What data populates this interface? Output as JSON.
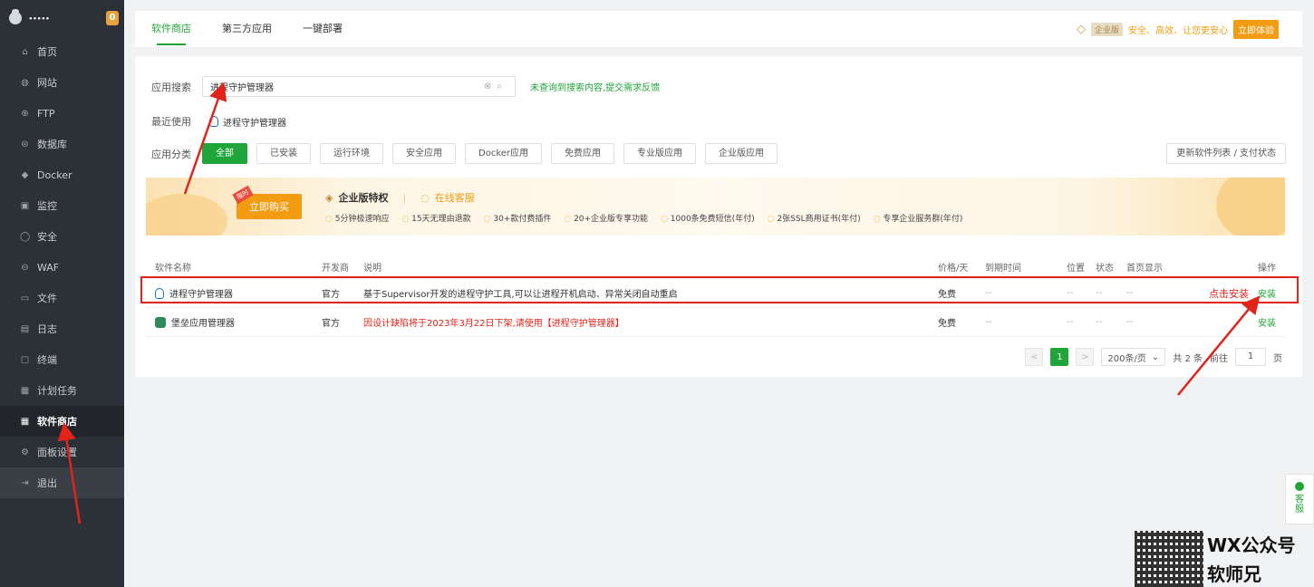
{
  "sidebar": {
    "username": "🞄🞄🞄🞄🞄",
    "badge": "0",
    "items": [
      {
        "label": "首页",
        "icon": "⌂"
      },
      {
        "label": "网站",
        "icon": "◍"
      },
      {
        "label": "FTP",
        "icon": "⊕"
      },
      {
        "label": "数据库",
        "icon": "⊜"
      },
      {
        "label": "Docker",
        "icon": "◆"
      },
      {
        "label": "监控",
        "icon": "▣"
      },
      {
        "label": "安全",
        "icon": "◯"
      },
      {
        "label": "WAF",
        "icon": "⊖"
      },
      {
        "label": "文件",
        "icon": "▭"
      },
      {
        "label": "日志",
        "icon": "▤"
      },
      {
        "label": "终端",
        "icon": "▢"
      },
      {
        "label": "计划任务",
        "icon": "▦"
      },
      {
        "label": "软件商店",
        "icon": "▦"
      },
      {
        "label": "面板设置",
        "icon": "⚙"
      },
      {
        "label": "退出",
        "icon": "⇥"
      }
    ]
  },
  "topbar": {
    "tabs": [
      "软件商店",
      "第三方应用",
      "一键部署"
    ],
    "ent_tag": "企业版",
    "ent_text": "安全、高效、让您更安心",
    "ent_btn": "立即体验"
  },
  "search": {
    "label": "应用搜索",
    "value": "进程守护管理器",
    "feedback": "未查询到搜索内容,提交需求反馈"
  },
  "recent": {
    "label": "最近使用",
    "item": "进程守护管理器"
  },
  "category": {
    "label": "应用分类",
    "items": [
      "全部",
      "已安装",
      "运行环境",
      "安全应用",
      "Docker应用",
      "免费应用",
      "专业版应用",
      "企业版应用"
    ],
    "refresh": "更新软件列表 / 支付状态"
  },
  "banner": {
    "buy": "立即购买",
    "hot": "限时",
    "privilege": "企业版特权",
    "service": "在线客服",
    "features": [
      "5分钟极速响应",
      "15天无理由退款",
      "30+款付费插件",
      "20+企业版专享功能",
      "1000条免费短信(年付)",
      "2张SSL商用证书(年付)",
      "专享企业服务群(年付)"
    ]
  },
  "table": {
    "headers": {
      "name": "软件名称",
      "dev": "开发商",
      "desc": "说明",
      "price": "价格/天",
      "expire": "到期时间",
      "loc": "位置",
      "status": "状态",
      "home": "首页显示",
      "op": "操作"
    },
    "rows": [
      {
        "name": "进程守护管理器",
        "dev": "官方",
        "desc": "基于Supervisor开发的进程守护工具,可以让进程开机启动、异常关闭自动重启",
        "price": "免费",
        "expire": "--",
        "loc": "--",
        "status": "--",
        "home": "--",
        "op": "安装"
      },
      {
        "name": "堡垒应用管理器",
        "dev": "官方",
        "desc": "因设计缺陷将于2023年3月22日下架,请使用【进程守护管理器】",
        "price": "免费",
        "expire": "--",
        "loc": "--",
        "status": "--",
        "home": "--",
        "op": "安装"
      }
    ],
    "click_hint": "点击安装"
  },
  "pager": {
    "prev": "<",
    "page": "1",
    "next": ">",
    "size": "200条/页",
    "total": "共 2 条",
    "goto": "前往",
    "goto_value": "1",
    "unit": "页"
  },
  "kefu": {
    "label1": "客",
    "label2": "服"
  },
  "watermark": {
    "line1": "WX公众号",
    "line2": "软师兄"
  },
  "colors": {
    "accent": "#20a53a",
    "warning": "#f39c12",
    "annotation": "#e2231a",
    "sidebar": "#2c3138"
  }
}
